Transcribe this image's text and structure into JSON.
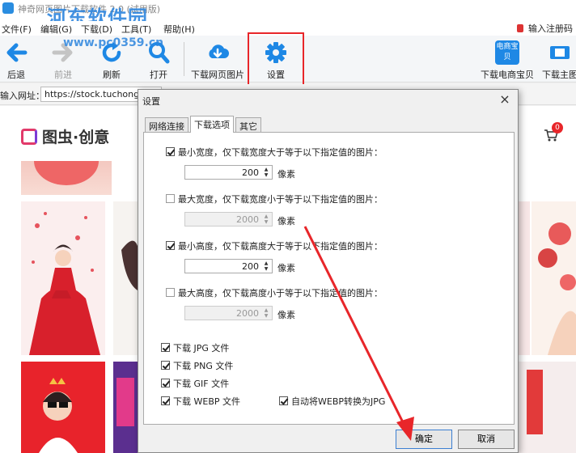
{
  "window": {
    "title": "神奇网页图片下载软件 2.0 (试用版)",
    "watermark": "河东软件园",
    "watermark_url": "www.pc0359.cn"
  },
  "menu": {
    "items": [
      "文件(F)",
      "编辑(G)",
      "下载(D)",
      "工具(T)",
      "帮助(H)"
    ],
    "register": "输入注册码"
  },
  "toolbar": {
    "back": "后退",
    "forward": "前进",
    "refresh": "刷新",
    "open": "打开",
    "download_images": "下载网页图片",
    "settings": "设置",
    "ecommerce_badge": "电商宝贝",
    "ecommerce": "下载电商宝贝",
    "main_image": "下载主图"
  },
  "address": {
    "label": "输入网址：",
    "value": "https://stock.tuchong."
  },
  "site": {
    "logo": "图虫·创意",
    "cart_count": "0"
  },
  "dialog": {
    "title": "设置",
    "close": "×",
    "tabs": [
      "网络连接",
      "下载选项",
      "其它"
    ],
    "options": [
      {
        "label": "最小宽度，仅下载宽度大于等于以下指定值的图片：",
        "checked": true,
        "value": "200",
        "unit": "像素"
      },
      {
        "label": "最大宽度，仅下载宽度小于等于以下指定值的图片：",
        "checked": false,
        "value": "2000",
        "unit": "像素"
      },
      {
        "label": "最小高度，仅下载高度大于等于以下指定值的图片：",
        "checked": true,
        "value": "200",
        "unit": "像素"
      },
      {
        "label": "最大高度，仅下载高度小于等于以下指定值的图片：",
        "checked": false,
        "value": "2000",
        "unit": "像素"
      }
    ],
    "file_types": [
      {
        "label": "下载 JPG 文件",
        "checked": true
      },
      {
        "label": "下载 PNG 文件",
        "checked": true
      },
      {
        "label": "下载 GIF 文件",
        "checked": true
      },
      {
        "label": "下载 WEBP 文件",
        "checked": true
      }
    ],
    "webp_convert": {
      "label": "自动将WEBP转换为JPG",
      "checked": true
    },
    "ok": "确定",
    "cancel": "取消"
  },
  "colors": {
    "annotation_red": "#e8262a",
    "toolbar_blue": "#1e88e5"
  }
}
